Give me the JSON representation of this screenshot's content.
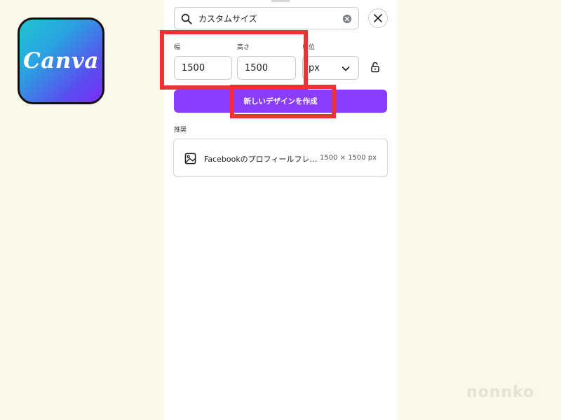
{
  "app_icon": {
    "label": "Canva",
    "gradient": [
      "#1fc6d3",
      "#7b2ff7"
    ]
  },
  "search": {
    "value": "カスタムサイズ"
  },
  "dimensions": {
    "width_label": "幅",
    "width_value": "1500",
    "height_label": "高さ",
    "height_value": "1500",
    "unit_label": "単位",
    "unit_value": "px"
  },
  "create_button": {
    "label": "新しいデザインを作成",
    "color": "#8b3dff"
  },
  "suggestions": {
    "heading": "推奨",
    "items": [
      {
        "title": "Facebookのプロフィールフレ…",
        "size": "1500 × 1500 px"
      }
    ]
  },
  "annotations": {
    "highlight_color": "#ef3134"
  },
  "watermark": "nonnko"
}
